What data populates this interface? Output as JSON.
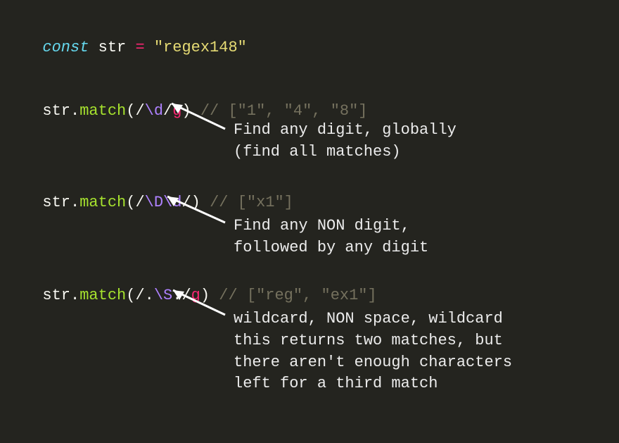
{
  "line1": {
    "const": "const",
    "sp1": " ",
    "var": "str",
    "sp2": " ",
    "eq": "=",
    "sp3": " ",
    "string": "\"regex148\""
  },
  "line2": {
    "obj": "str",
    "dot": ".",
    "method": "match",
    "lp": "(",
    "s1": "/",
    "esc": "\\d",
    "s2": "/",
    "flag": "g",
    "rp": ")",
    "sp": " ",
    "comment": "// [\"1\", \"4\", \"8\"]"
  },
  "line3": {
    "obj": "str",
    "dot": ".",
    "method": "match",
    "lp": "(",
    "s1": "/",
    "esc1": "\\D",
    "esc2": "\\d",
    "s2": "/",
    "rp": ")",
    "sp": " ",
    "comment": "// [\"x1\"]"
  },
  "line4": {
    "obj": "str",
    "dot": ".",
    "method": "match",
    "lp": "(",
    "s1": "/",
    "d1": ".",
    "esc": "\\S",
    "d2": ".",
    "s2": "/",
    "flag": "g",
    "rp": ")",
    "sp": " ",
    "comment": "// [\"reg\", \"ex1\"]"
  },
  "ann1": "Find any digit, globally\n(find all matches)",
  "ann2": "Find any NON digit,\nfollowed by any digit",
  "ann3": "wildcard, NON space, wildcard\nthis returns two matches, but\nthere aren't enough characters\nleft for a third match"
}
